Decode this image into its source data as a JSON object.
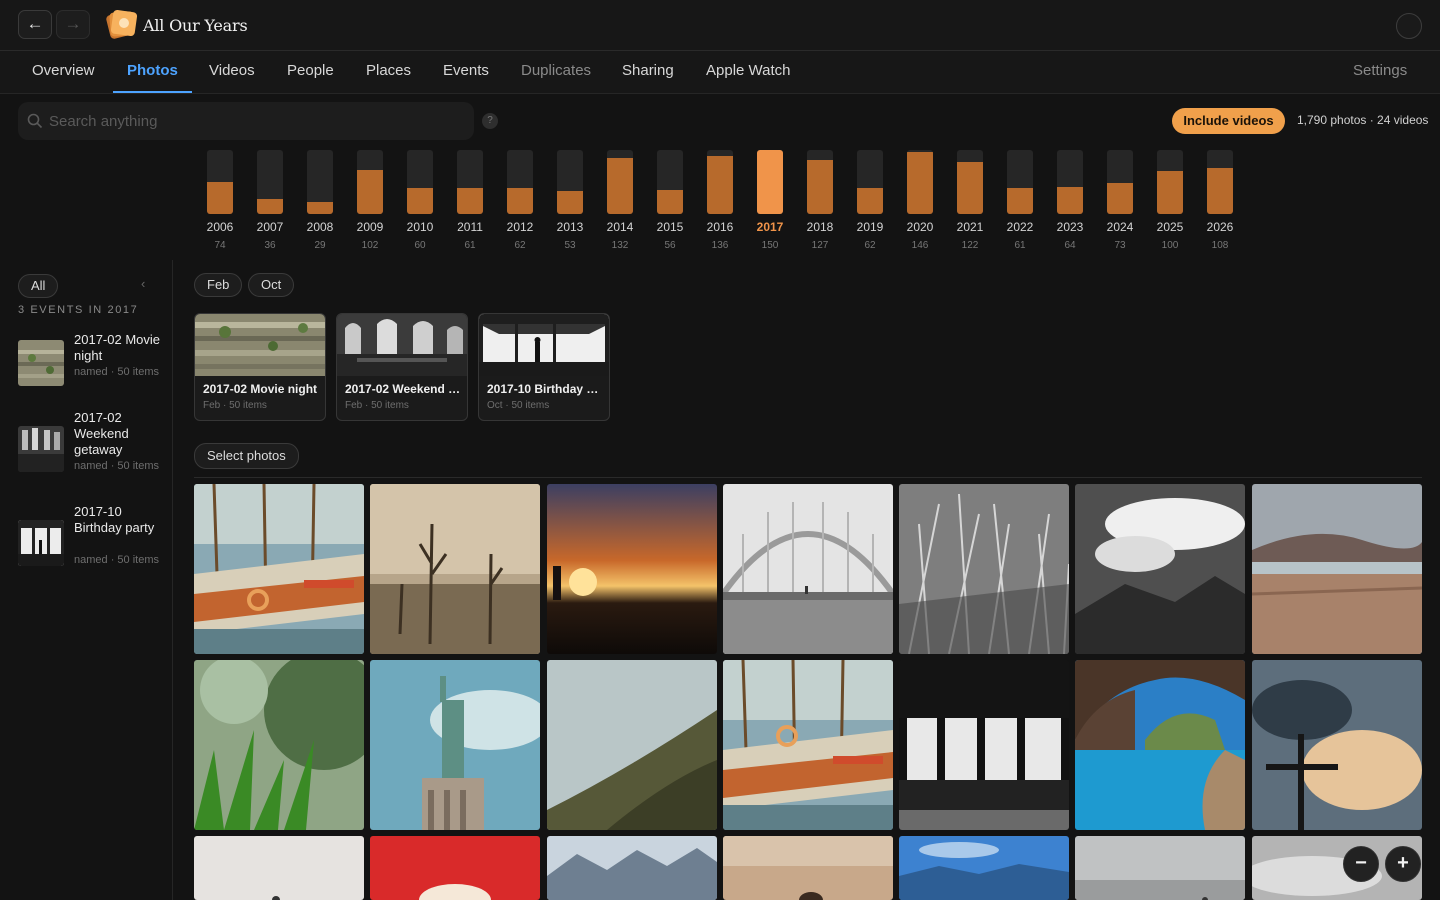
{
  "app": {
    "title": "All Our Years"
  },
  "nav": {
    "back_glyph": "←",
    "forward_glyph": "→"
  },
  "tabs": [
    {
      "label": "Overview"
    },
    {
      "label": "Photos"
    },
    {
      "label": "Videos"
    },
    {
      "label": "People"
    },
    {
      "label": "Places"
    },
    {
      "label": "Events"
    },
    {
      "label": "Duplicates"
    },
    {
      "label": "Sharing"
    },
    {
      "label": "Apple Watch"
    }
  ],
  "settings_label": "Settings",
  "active_tab": "Photos",
  "search": {
    "placeholder": "Search anything",
    "help_glyph": "?"
  },
  "include_videos_label": "Include videos",
  "counts": "1,790 photos · 24 videos",
  "selected_year": "2017",
  "years": [
    {
      "year": "2006",
      "count": "74"
    },
    {
      "year": "2007",
      "count": "36"
    },
    {
      "year": "2008",
      "count": "29"
    },
    {
      "year": "2009",
      "count": "102"
    },
    {
      "year": "2010",
      "count": "60"
    },
    {
      "year": "2011",
      "count": "61"
    },
    {
      "year": "2012",
      "count": "62"
    },
    {
      "year": "2013",
      "count": "53"
    },
    {
      "year": "2014",
      "count": "132"
    },
    {
      "year": "2015",
      "count": "56"
    },
    {
      "year": "2016",
      "count": "136"
    },
    {
      "year": "2017",
      "count": "150"
    },
    {
      "year": "2018",
      "count": "127"
    },
    {
      "year": "2019",
      "count": "62"
    },
    {
      "year": "2020",
      "count": "146"
    },
    {
      "year": "2021",
      "count": "122"
    },
    {
      "year": "2022",
      "count": "61"
    },
    {
      "year": "2023",
      "count": "64"
    },
    {
      "year": "2024",
      "count": "73"
    },
    {
      "year": "2025",
      "count": "100"
    },
    {
      "year": "2026",
      "count": "108"
    }
  ],
  "sidebar": {
    "filter_all": "All",
    "collapse_glyph": "‹",
    "events_heading": "3 EVENTS IN 2017",
    "events": [
      {
        "title": "2017-02 Movie night",
        "meta": "named · 50 items"
      },
      {
        "title": "2017-02 Weekend getaway",
        "meta": "named · 50 items"
      },
      {
        "title": "2017-10 Birthday party",
        "meta": "named · 50 items"
      }
    ]
  },
  "months": [
    "Feb",
    "Oct"
  ],
  "event_cards": [
    {
      "title": "2017-02 Movie night",
      "meta": "Feb · 50 items"
    },
    {
      "title": "2017-02 Weekend getaway",
      "meta": "Feb · 50 items"
    },
    {
      "title": "2017-10 Birthday party",
      "meta": "Oct · 50 items"
    }
  ],
  "select_photos_label": "Select photos",
  "zoom": {
    "out_glyph": "−",
    "in_glyph": "+"
  }
}
